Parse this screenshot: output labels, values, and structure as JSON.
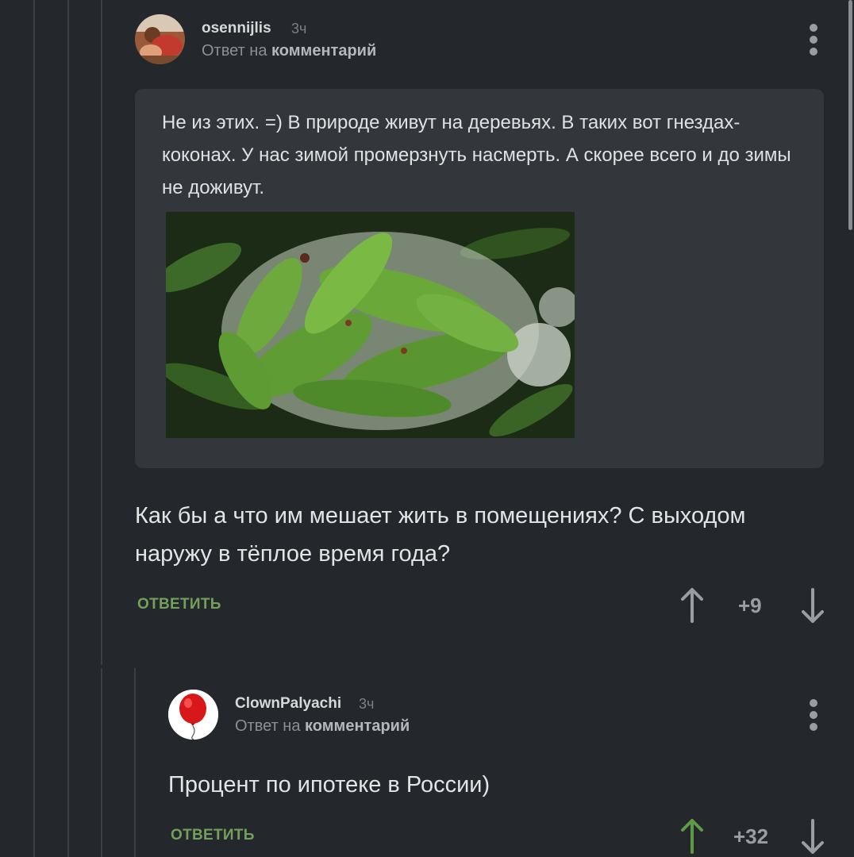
{
  "comment1": {
    "username": "osennijlis",
    "time": "3ч",
    "reply_prefix": "Ответ на",
    "reply_target": "комментарий",
    "quote": "Не из этих. =) В природе живут на деревьях. В таких вот гнездах-коконах. У нас зимой промерзнуть насмерть. А скорее всего и до зимы не доживут.",
    "body": "Как бы а что им мешает жить в помещениях? С выходом наружу в тёплое время года?",
    "reply_label": "ОТВЕТИТЬ",
    "score": "+9"
  },
  "comment2": {
    "username": "ClownPalyachi",
    "time": "3ч",
    "reply_prefix": "Ответ на",
    "reply_target": "комментарий",
    "body": "Процент по ипотеке в России)",
    "reply_label": "ОТВЕТИТЬ",
    "score": "+32"
  },
  "colors": {
    "background": "#24272b",
    "quote_background": "#33373c",
    "reply_green": "#73a05a",
    "upvote_active": "#5f9a48",
    "arrow_inactive": "#9a9ea3"
  },
  "icons": [
    "more-vertical-icon",
    "upvote-arrow-icon",
    "downvote-arrow-icon",
    "red-balloon-avatar"
  ]
}
